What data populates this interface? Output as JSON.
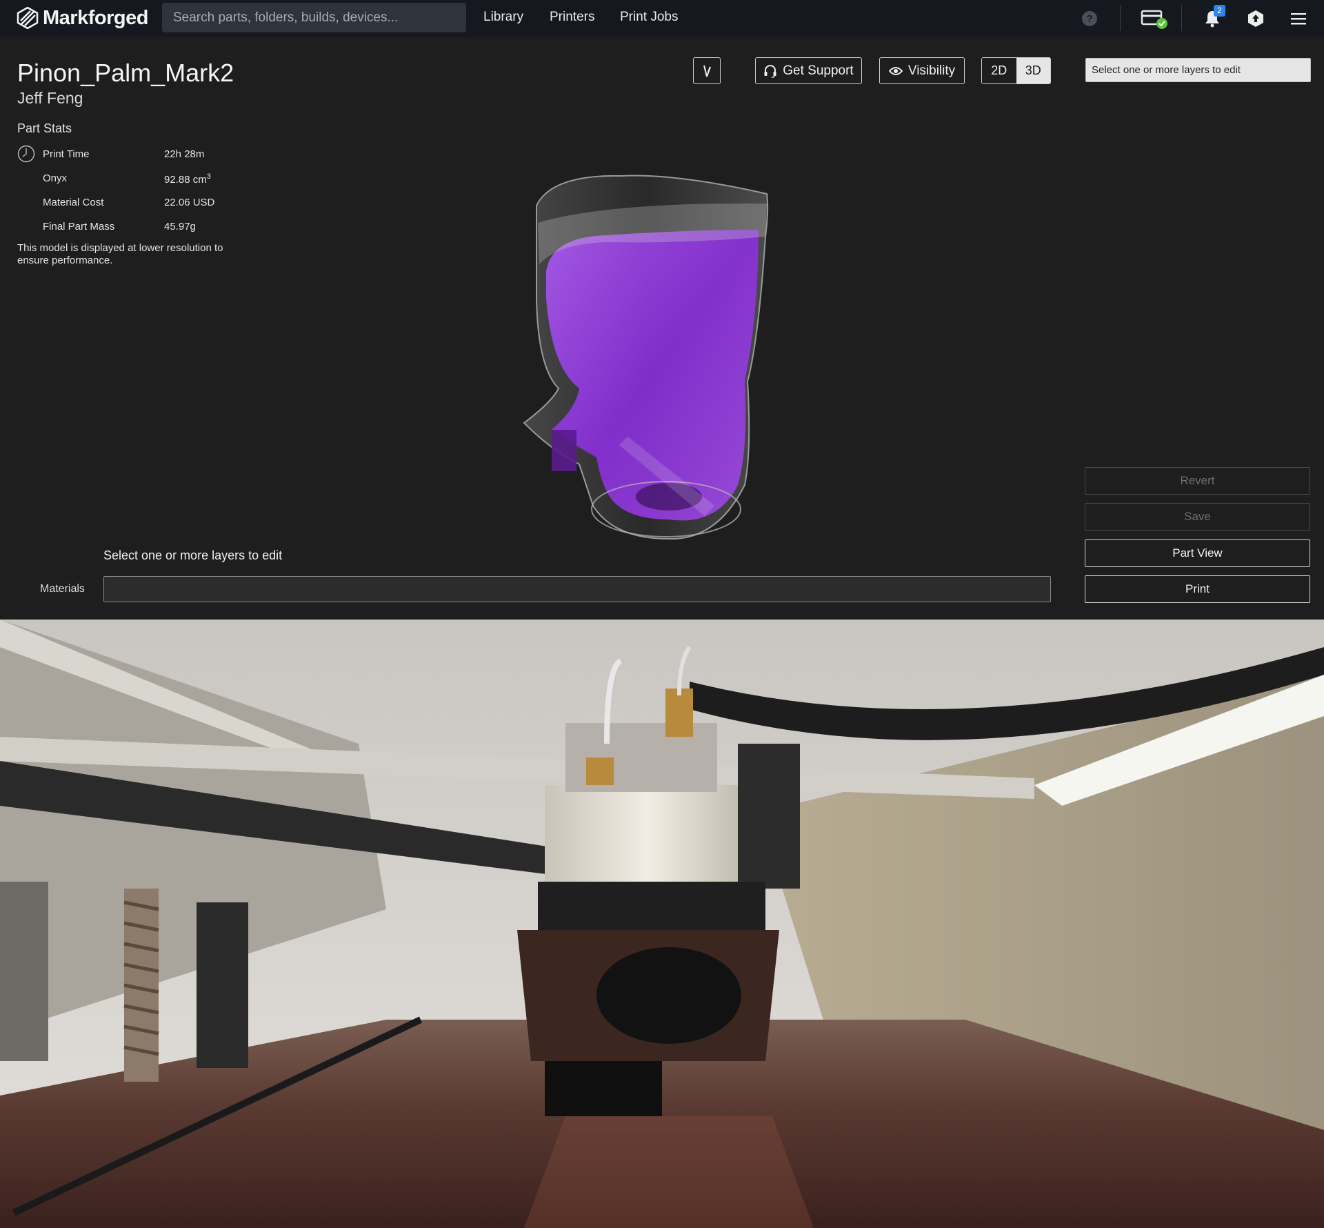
{
  "app": {
    "brand": "Markforged",
    "search_placeholder": "Search parts, folders, builds, devices...",
    "nav": [
      "Library",
      "Printers",
      "Print Jobs"
    ],
    "notification_count": "2",
    "icons": [
      "help-icon",
      "device-status-icon",
      "bell-icon",
      "account-icon",
      "menu-icon"
    ],
    "accent_color": "#2d86e6",
    "status_ok_color": "#5cc23c"
  },
  "part": {
    "name": "Pinon_Palm_Mark2",
    "owner": "Jeff Feng",
    "stats_title": "Part Stats",
    "stats": [
      {
        "label": "Print Time",
        "value": "22h 28m",
        "icon": "clock-icon"
      },
      {
        "label": "Onyx",
        "value": "92.88 cm",
        "unit_sup": "3"
      },
      {
        "label": "Material Cost",
        "value": "22.06 USD"
      },
      {
        "label": "Final Part Mass",
        "value": "45.97g"
      }
    ],
    "resolution_note": "This model is displayed at lower resolution to ensure performance.",
    "fill_color": "#9b3cff"
  },
  "toolbar": {
    "get_support": "Get Support",
    "visibility": "Visibility",
    "view_2d": "2D",
    "view_3d": "3D",
    "active_view": "3D"
  },
  "layers": {
    "select_placeholder": "Select one or more layers to edit",
    "edit_hint": "Select one or more layers to edit",
    "materials_label": "Materials"
  },
  "actions": {
    "revert": "Revert",
    "save": "Save",
    "part_view": "Part View",
    "print": "Print"
  }
}
